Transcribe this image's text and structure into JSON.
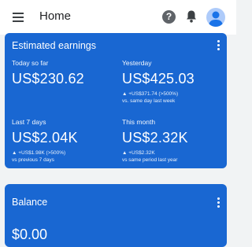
{
  "header": {
    "title": "Home"
  },
  "earnings_card": {
    "title": "Estimated earnings",
    "metrics": [
      {
        "label": "Today so far",
        "value": "US$230.62",
        "change": "",
        "compare": ""
      },
      {
        "label": "Yesterday",
        "value": "US$425.03",
        "change": "▲ +US$371.74 (>500%)",
        "compare": "vs. same day last week"
      },
      {
        "label": "Last 7 days",
        "value": "US$2.04K",
        "change": "▲ +US$1.98K (>500%)",
        "compare": "vs previous 7 days"
      },
      {
        "label": "This month",
        "value": "US$2.32K",
        "change": "▲ +US$2.32K",
        "compare": "vs same period last year"
      }
    ]
  },
  "balance_card": {
    "title": "Balance",
    "value": "$0.00"
  },
  "colors": {
    "card_blue": "#1967d2",
    "background": "#f1f3f4"
  }
}
